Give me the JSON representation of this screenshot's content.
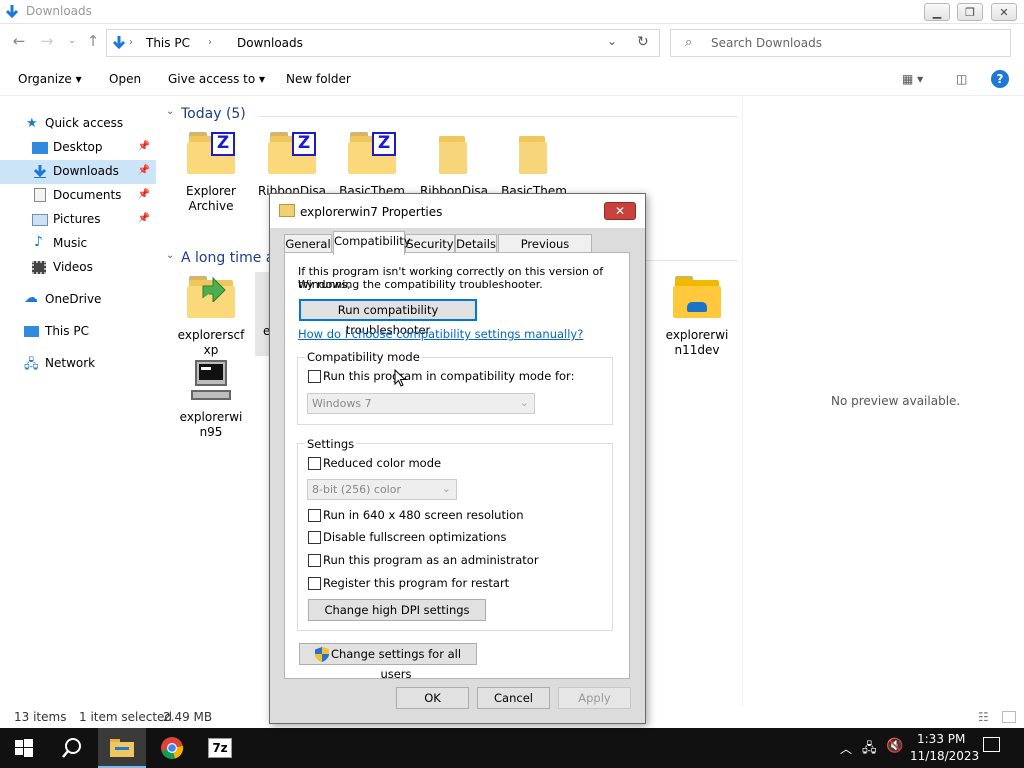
{
  "window": {
    "title": "Downloads"
  },
  "nav": {
    "address_segments": [
      "This PC",
      "Downloads"
    ],
    "search_placeholder": "Search Downloads"
  },
  "toolbar": {
    "organize": "Organize",
    "open": "Open",
    "give_access": "Give access to",
    "new_folder": "New folder"
  },
  "sidebar": {
    "items": [
      {
        "label": "Quick access"
      },
      {
        "label": "Desktop"
      },
      {
        "label": "Downloads"
      },
      {
        "label": "Documents"
      },
      {
        "label": "Pictures"
      },
      {
        "label": "Music"
      },
      {
        "label": "Videos"
      },
      {
        "label": "OneDrive"
      },
      {
        "label": "This PC"
      },
      {
        "label": "Network"
      }
    ]
  },
  "content": {
    "group_today": "Today (5)",
    "group_longtime": "A long time a",
    "today_items": [
      {
        "label": "Explorer Archive"
      },
      {
        "label": "RibbonDisa"
      },
      {
        "label": "BasicThem"
      },
      {
        "label": "RibbonDisa"
      },
      {
        "label": "BasicThem"
      }
    ],
    "old_items": [
      {
        "label": "explorerscf xp"
      },
      {
        "label": "e"
      },
      {
        "label": "explorerwi n11dev"
      },
      {
        "label": "explorerwi n95"
      }
    ]
  },
  "preview": {
    "text": "No preview available."
  },
  "status": {
    "count": "13 items",
    "selected": "1 item selected",
    "size": "2.49 MB"
  },
  "taskbar": {
    "time": "1:33 PM",
    "date": "11/18/2023",
    "app_7z": "7z"
  },
  "dialog": {
    "title": "explorerwin7 Properties",
    "tabs": [
      "General",
      "Compatibility",
      "Security",
      "Details",
      "Previous Versions"
    ],
    "intro_line1": "If this program isn't working correctly on this version of Windows,",
    "intro_line2": "try running the compatibility troubleshooter.",
    "troubleshooter_button": "Run compatibility troubleshooter",
    "help_link": "How do I choose compatibility settings manually?",
    "compat_group": "Compatibility mode",
    "compat_checkbox": "Run this program in compatibility mode for:",
    "compat_select": "Windows 7",
    "settings_group": "Settings",
    "reduced_color": "Reduced color mode",
    "color_select": "8-bit (256) color",
    "res_640": "Run in 640 x 480 screen resolution",
    "disable_fullscreen": "Disable fullscreen optimizations",
    "run_admin": "Run this program as an administrator",
    "register_restart": "Register this program for restart",
    "dpi_button": "Change high DPI settings",
    "all_users_button": "Change settings for all users",
    "ok": "OK",
    "cancel": "Cancel",
    "apply": "Apply"
  }
}
